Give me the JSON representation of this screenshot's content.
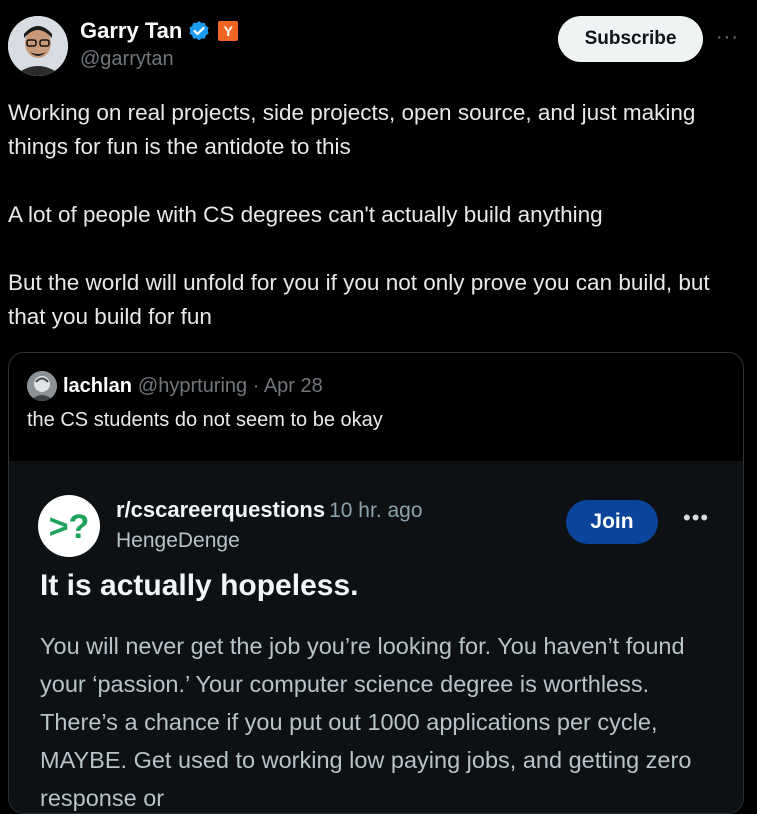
{
  "author": {
    "name": "Garry Tan",
    "handle": "@garrytan",
    "yc_badge": "Y"
  },
  "actions": {
    "subscribe": "Subscribe",
    "more": "···"
  },
  "tweet": {
    "paragraphs": [
      "Working on real projects, side projects, open source, and just making things for fun is the antidote to this",
      "A lot of people with CS degrees can't actually build anything",
      "But the world will unfold for you if you not only prove you can build, but that you build for fun"
    ]
  },
  "quoted": {
    "name": "lachlan",
    "handle_time": "@hyprturing · Apr 28",
    "text": "the CS students do not seem to be okay",
    "reddit": {
      "subreddit": "r/cscareerquestions",
      "time": "10 hr. ago",
      "user": "HengeDenge",
      "join": "Join",
      "more": "•••",
      "title": "It is actually hopeless.",
      "body": "You will never get the job you’re looking for. You haven’t found your ‘passion.’ Your computer science degree is worthless. There’s a chance if you put out 1000 applications per cycle, MAYBE. Get used to working low paying jobs, and getting zero response or"
    }
  },
  "colors": {
    "verified": "#1d9bf0",
    "yc": "#f26522",
    "join": "#0a449b",
    "reddit_icon": "#1fa35a"
  }
}
